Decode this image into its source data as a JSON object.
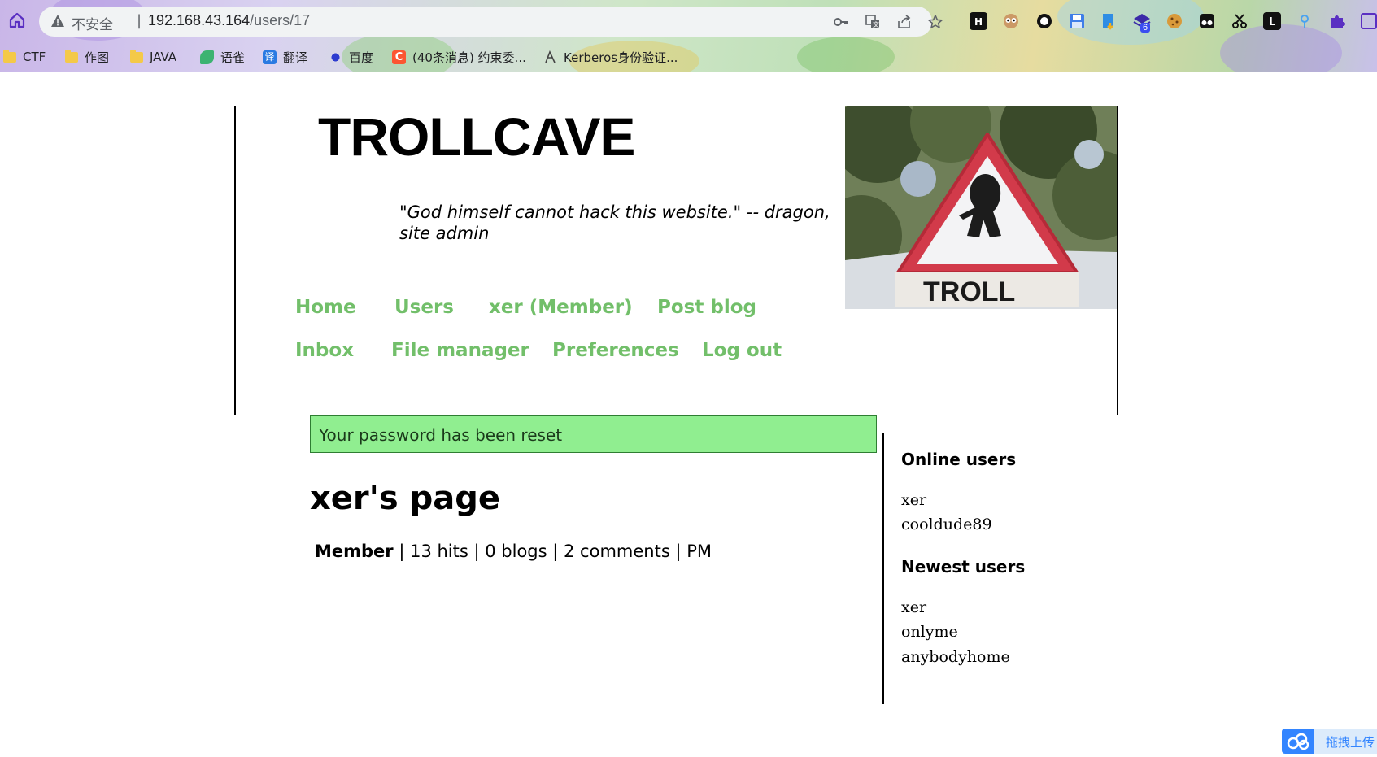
{
  "browser": {
    "security_label": "不安全",
    "url_host": "192.168.43.164",
    "url_path": "/users/17",
    "extension_badge": "6",
    "bookmarks": [
      {
        "label": "CTF",
        "icon": "folder-icon"
      },
      {
        "label": "作图",
        "icon": "folder-icon"
      },
      {
        "label": "JAVA",
        "icon": "folder-icon"
      },
      {
        "label": "语雀",
        "icon": "yuque-icon"
      },
      {
        "label": "翻译",
        "icon": "translate-icon"
      },
      {
        "label": "百度",
        "icon": "baidu-icon"
      },
      {
        "label": "(40条消息) 约束委...",
        "icon": "csdn-icon"
      },
      {
        "label": "Kerberos身份验证...",
        "icon": "kerberos-icon"
      }
    ]
  },
  "site": {
    "title": "TROLLCAVE",
    "quote": "\"God himself cannot hack this website.\" -- dragon, site admin",
    "image_caption": "TROLL"
  },
  "nav": {
    "home": "Home",
    "users": "Users",
    "profile": "xer (Member)",
    "post_blog": "Post blog",
    "inbox": "Inbox",
    "file_manager": "File manager",
    "preferences": "Preferences",
    "log_out": "Log out"
  },
  "alert": {
    "message": "Your password has been reset",
    "color": "#90ee90"
  },
  "profile": {
    "page_title": "xer's page",
    "role": "Member",
    "hits": "13 hits",
    "blogs": "0 blogs",
    "comments": "2 comments",
    "pm": "PM"
  },
  "sidebar": {
    "online_heading": "Online users",
    "online_users": [
      "xer",
      "cooldude89"
    ],
    "newest_heading": "Newest users",
    "newest_users": [
      "xer",
      "onlyme",
      "anybodyhome"
    ]
  },
  "upload_widget": {
    "label": "拖拽上传"
  },
  "colors": {
    "nav_link": "#72bf6a",
    "accent": "#5a2fc2"
  }
}
